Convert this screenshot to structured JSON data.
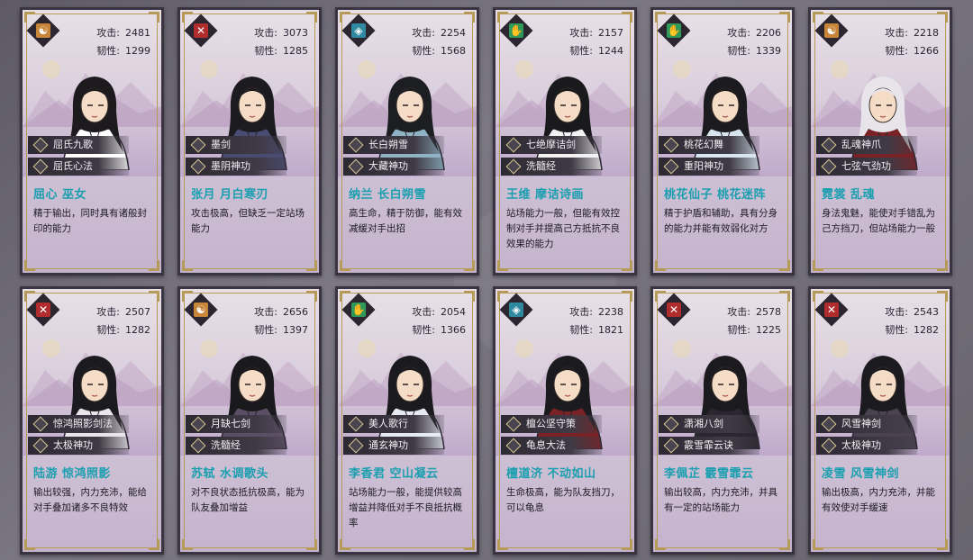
{
  "stat_labels": {
    "attack": "攻击:",
    "toughness": "韧性:"
  },
  "cards": [
    {
      "attack": "2481",
      "toughness": "1299",
      "skill1": "屈氏九歌",
      "skill2": "屈氏心法",
      "name": "屈心 巫女",
      "desc": "精于输出，同时具有诸般封印的能力",
      "emblem": "yinyang-icon",
      "emblem_color": "#c8863a",
      "emblem_glyph": "☯",
      "robe": "#ffffff",
      "hair": "#1d1a1e"
    },
    {
      "attack": "3073",
      "toughness": "1285",
      "skill1": "墨剑",
      "skill2": "墨阴神功",
      "name": "张月 月白寒刃",
      "desc": "攻击极高，但缺乏一定站场能力",
      "emblem": "crossed-swords-icon",
      "emblem_color": "#b12d2d",
      "emblem_glyph": "✕",
      "robe": "#4a4b70",
      "hair": "#1c1b20"
    },
    {
      "attack": "2254",
      "toughness": "1568",
      "skill1": "长白朔雪",
      "skill2": "大藏神功",
      "name": "纳兰 长白朔雪",
      "desc": "高生命，精于防御，能有效减缓对手出招",
      "emblem": "shield-icon",
      "emblem_color": "#2f8aa0",
      "emblem_glyph": "◈",
      "robe": "#8fb3c4",
      "hair": "#1d1e22"
    },
    {
      "attack": "2157",
      "toughness": "1244",
      "skill1": "七绝摩诘剑",
      "skill2": "洗髓经",
      "name": "王维 摩诘诗画",
      "desc": "站场能力一般，但能有效控制对手并提高己方抵抗不良效果的能力",
      "emblem": "hand-icon",
      "emblem_color": "#2f9a5a",
      "emblem_glyph": "✋",
      "robe": "#f2f2f2",
      "hair": "#1a1a1d"
    },
    {
      "attack": "2206",
      "toughness": "1339",
      "skill1": "桃花幻舞",
      "skill2": "重阳神功",
      "name": "桃花仙子 桃花迷阵",
      "desc": "精于护盾和辅助，具有分身的能力并能有效弱化对方",
      "emblem": "hand-icon",
      "emblem_color": "#2f9a5a",
      "emblem_glyph": "✋",
      "robe": "#d7e6ef",
      "hair": "#1b1a1f"
    },
    {
      "attack": "2218",
      "toughness": "1266",
      "skill1": "乱魂神爪",
      "skill2": "七弦气劲功",
      "name": "霓裳 乱魂",
      "desc": "身法鬼魅，能使对手错乱为己方挡刀，但站场能力一般",
      "emblem": "yinyang-icon",
      "emblem_color": "#c8863a",
      "emblem_glyph": "☯",
      "robe": "#7a2326",
      "hair": "#e7e5ea"
    },
    {
      "attack": "2507",
      "toughness": "1282",
      "skill1": "惊鸿照影剑法",
      "skill2": "太极神功",
      "name": "陆游 惊鸿照影",
      "desc": "输出较强，内力充沛，能给对手叠加诸多不良特效",
      "emblem": "crossed-swords-icon",
      "emblem_color": "#b12d2d",
      "emblem_glyph": "✕",
      "robe": "#e8e4ea",
      "hair": "#1b1a1e"
    },
    {
      "attack": "2656",
      "toughness": "1397",
      "skill1": "月缺七剑",
      "skill2": "洗髓经",
      "name": "苏轼 水调歌头",
      "desc": "对不良状态抵抗极高，能为队友叠加增益",
      "emblem": "yinyang-icon",
      "emblem_color": "#c8863a",
      "emblem_glyph": "☯",
      "robe": "#5c4f65",
      "hair": "#1a1a1d"
    },
    {
      "attack": "2054",
      "toughness": "1366",
      "skill1": "美人歌行",
      "skill2": "通玄神功",
      "name": "李香君 空山凝云",
      "desc": "站场能力一般，能提供较高增益并降低对手不良抵抗概率",
      "emblem": "hand-icon",
      "emblem_color": "#2f9a5a",
      "emblem_glyph": "✋",
      "robe": "#e6eaf2",
      "hair": "#1b1a1e"
    },
    {
      "attack": "2238",
      "toughness": "1821",
      "skill1": "檀公坚守策",
      "skill2": "龟息大法",
      "name": "檀道济 不动如山",
      "desc": "生命极高，能为队友挡刀，可以龟息",
      "emblem": "shield-icon",
      "emblem_color": "#2f8aa0",
      "emblem_glyph": "◈",
      "robe": "#7a2326",
      "hair": "#1b1a1e"
    },
    {
      "attack": "2578",
      "toughness": "1225",
      "skill1": "潇湘八剑",
      "skill2": "霰雪霏云诀",
      "name": "李佩芷 霰雪霏云",
      "desc": "输出较高，内力充沛，并具有一定的站场能力",
      "emblem": "crossed-swords-icon",
      "emblem_color": "#b12d2d",
      "emblem_glyph": "✕",
      "robe": "#2a2730",
      "hair": "#1b1a1e"
    },
    {
      "attack": "2543",
      "toughness": "1282",
      "skill1": "风雪神剑",
      "skill2": "太极神功",
      "name": "凌雪 风雪神剑",
      "desc": "输出极高，内力充沛，并能有效使对手缓速",
      "emblem": "crossed-swords-icon",
      "emblem_color": "#b12d2d",
      "emblem_glyph": "✕",
      "robe": "#4a4250",
      "hair": "#1b1a1e"
    }
  ]
}
